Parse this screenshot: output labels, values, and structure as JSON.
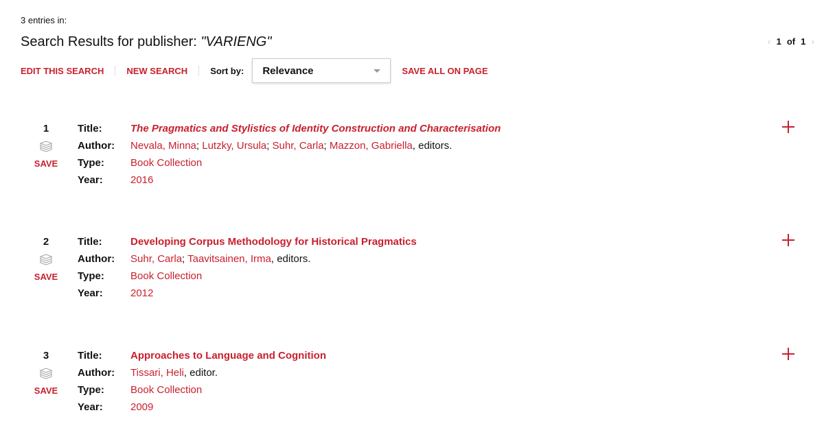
{
  "header": {
    "entries_text": "3 entries in:",
    "title_prefix": "Search Results for publisher: ",
    "title_query": "\"VARIENG\""
  },
  "pager": {
    "current": "1",
    "of_label": "of",
    "total": "1",
    "prev_icon": "chevron-left-icon",
    "next_icon": "chevron-right-icon"
  },
  "toolbar": {
    "edit_search": "EDIT THIS SEARCH",
    "new_search": "NEW SEARCH",
    "sort_label": "Sort by:",
    "sort_value": "Relevance",
    "save_all": "SAVE ALL ON PAGE"
  },
  "labels": {
    "title": "Title:",
    "author": "Author:",
    "type": "Type:",
    "year": "Year:",
    "save": "SAVE"
  },
  "colors": {
    "accent": "#c8202d",
    "text": "#111111"
  },
  "results": [
    {
      "number": "1",
      "title": "The Pragmatics and Stylistics of Identity Construction and Characterisation",
      "title_italic": true,
      "authors": [
        "Nevala, Minna",
        "Lutzky, Ursula",
        "Suhr, Carla",
        "Mazzon, Gabriella"
      ],
      "author_suffix": ", editors.",
      "type": "Book Collection",
      "year": "2016"
    },
    {
      "number": "2",
      "title": "Developing Corpus Methodology for Historical Pragmatics",
      "title_italic": false,
      "authors": [
        "Suhr, Carla",
        "Taavitsainen, Irma"
      ],
      "author_suffix": ", editors.",
      "type": "Book Collection",
      "year": "2012"
    },
    {
      "number": "3",
      "title": "Approaches to Language and Cognition",
      "title_italic": false,
      "authors": [
        "Tissari, Heli"
      ],
      "author_suffix": ", editor.",
      "type": "Book Collection",
      "year": "2009"
    }
  ]
}
